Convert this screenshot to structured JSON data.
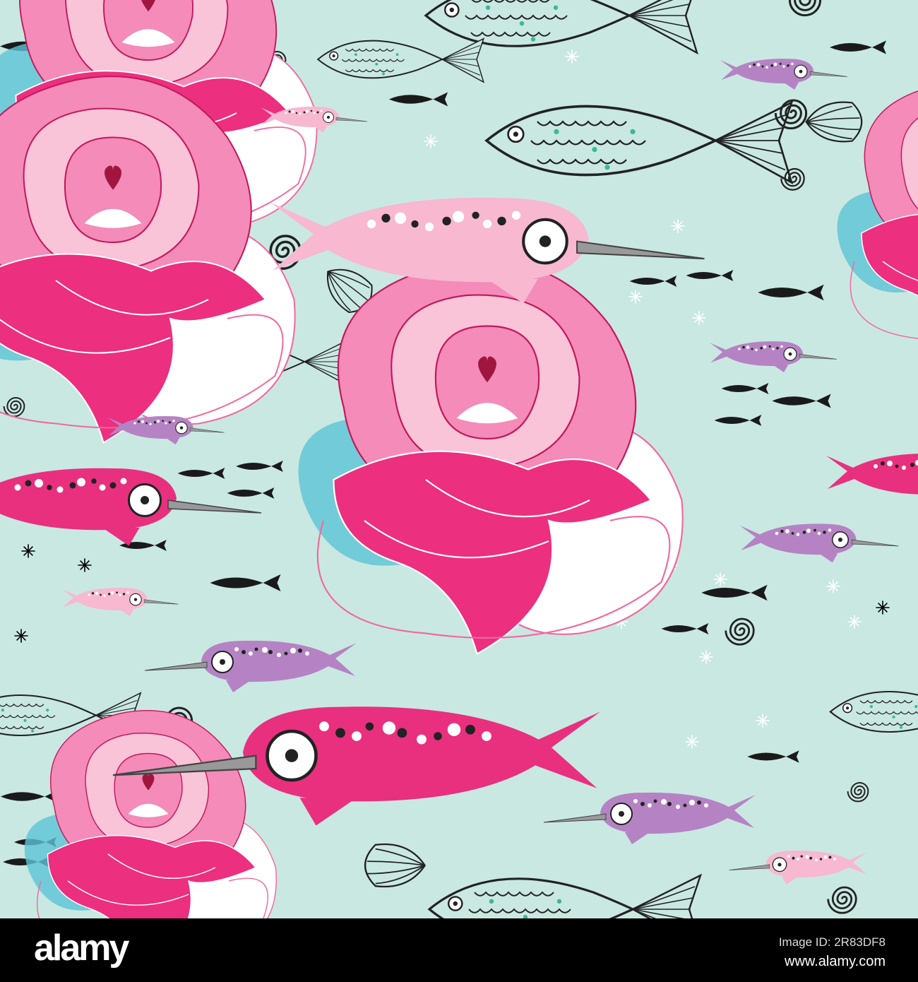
{
  "artwork": {
    "subject": "narwhals-fish-roses-pattern",
    "colors": {
      "background": "#c9e8e2",
      "pink": "#e8307f",
      "light_pink": "#f7b8d0",
      "purple": "#b583c3",
      "teal": "#5cc3d6"
    }
  },
  "footer": {
    "logo": "alamy",
    "image_id": "Image ID: 2R83DF8",
    "url": "www.alamy.com"
  }
}
